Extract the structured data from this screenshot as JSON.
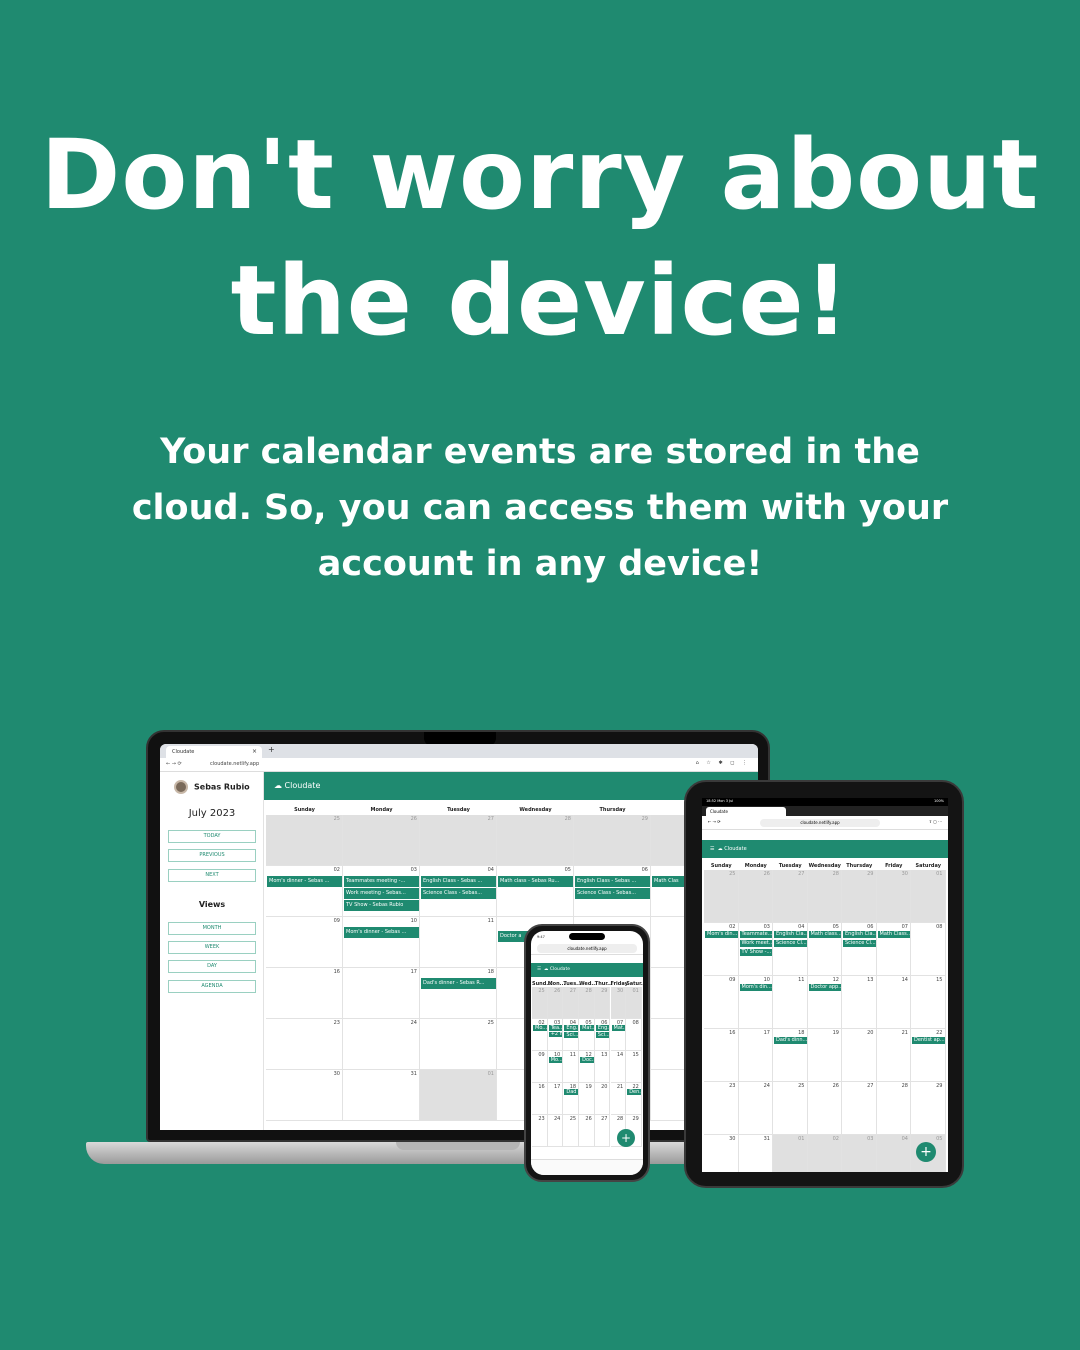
{
  "headline": "Don't worry about the device!",
  "subline": "Your calendar events are stored in the cloud. So, you can access them with your account in any device!",
  "colors": {
    "background": "#1f8a70",
    "accent": "#1f8a70",
    "text": "#ffffff"
  },
  "laptop": {
    "tab_title": "Cloudate",
    "url": "cloudate.netlify.app",
    "user_name": "Sebas Rubio",
    "month": "July 2023",
    "nav_buttons": [
      "TODAY",
      "PREVIOUS",
      "NEXT"
    ],
    "views_label": "Views",
    "view_buttons": [
      "MONTH",
      "WEEK",
      "DAY",
      "AGENDA"
    ],
    "app_title": "Cloudate",
    "weekdays": [
      "Sunday",
      "Monday",
      "Tuesday",
      "Wednesday",
      "Thursday",
      "F"
    ],
    "weeks": [
      [
        "25",
        "26",
        "27",
        "28",
        "29",
        ""
      ],
      [
        "02",
        "03",
        "04",
        "05",
        "06",
        ""
      ],
      [
        "09",
        "10",
        "11",
        "",
        "",
        ""
      ],
      [
        "16",
        "17",
        "18",
        "",
        "",
        ""
      ],
      [
        "23",
        "24",
        "25",
        "",
        "",
        ""
      ],
      [
        "30",
        "31",
        "01",
        "",
        "",
        ""
      ]
    ],
    "events": [
      "Mom's dinner - Sebas ...",
      "Teammates meeting -...",
      "Work meeting - Sebas...",
      "TV Show - Sebas Rubio",
      "English Class - Sebas ...",
      "Science Class - Sebas...",
      "Math class - Sebas Ru...",
      "English Class - Sebas ...",
      "Science Class - Sebas...",
      "Math Clas",
      "Mom's dinner - Sebas ...",
      "Doctor a",
      "Dad's dinner - Sebas R..."
    ]
  },
  "tablet": {
    "status_left": "18:52  Mon 3 Jul",
    "status_right": "100%",
    "tab_title": "Cloudate",
    "url": "cloudate.netlify.app",
    "app_title": "Cloudate",
    "weekdays": [
      "Sunday",
      "Monday",
      "Tuesday",
      "Wednesday",
      "Thursday",
      "Friday",
      "Saturday"
    ],
    "weeks": [
      [
        "25",
        "26",
        "27",
        "28",
        "29",
        "30",
        "01"
      ],
      [
        "02",
        "03",
        "04",
        "05",
        "06",
        "07",
        "08"
      ],
      [
        "09",
        "10",
        "11",
        "12",
        "13",
        "14",
        "15"
      ],
      [
        "16",
        "17",
        "18",
        "19",
        "20",
        "21",
        "22"
      ],
      [
        "23",
        "24",
        "25",
        "26",
        "27",
        "28",
        "29"
      ],
      [
        "30",
        "31",
        "01",
        "02",
        "03",
        "04",
        "05"
      ]
    ],
    "events": [
      "Mom's din...",
      "Teammate...",
      "Work meet...",
      "TV Show -...",
      "English Cla...",
      "Science Cl...",
      "Math class...",
      "English Cla...",
      "Science Cl...",
      "Math Class...",
      "Mom's din...",
      "Doctor app...",
      "Dad's dinn...",
      "Dentist ap..."
    ],
    "fab": "+"
  },
  "phone": {
    "status_time": "9:47",
    "url": "cloudate.netlify.app",
    "app_title": "Cloudate",
    "weekdays": [
      "Sund...",
      "Mon...",
      "Tues...",
      "Wed...",
      "Thur...",
      "Friday",
      "Satur..."
    ],
    "weeks": [
      [
        "25",
        "26",
        "27",
        "28",
        "29",
        "30",
        "01"
      ],
      [
        "02",
        "03",
        "04",
        "05",
        "06",
        "07",
        "08"
      ],
      [
        "09",
        "10",
        "11",
        "12",
        "13",
        "14",
        "15"
      ],
      [
        "16",
        "17",
        "18",
        "19",
        "20",
        "21",
        "22"
      ],
      [
        "23",
        "24",
        "25",
        "26",
        "27",
        "28",
        "29"
      ]
    ],
    "events": [
      "Mo...",
      "Tea...",
      "Eng...",
      "Mat...",
      "Eng...",
      "Mat...",
      "+2 more",
      "Sci...",
      "Sci...",
      "Mo...",
      "Doc...",
      "Dad",
      "Den..."
    ],
    "fab": "+"
  }
}
